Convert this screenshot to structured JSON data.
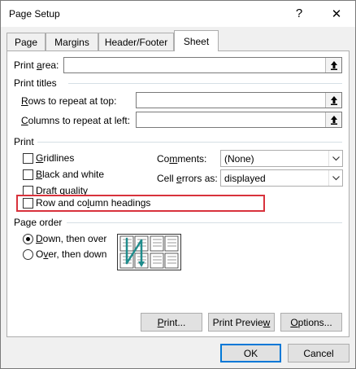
{
  "window": {
    "title": "Page Setup",
    "help_glyph": "?",
    "close_glyph": "✕"
  },
  "tabs": [
    {
      "label": "Page",
      "active": false
    },
    {
      "label": "Margins",
      "active": false
    },
    {
      "label": "Header/Footer",
      "active": false
    },
    {
      "label": "Sheet",
      "active": true
    }
  ],
  "print_area": {
    "label_pre": "Print ",
    "label_key": "a",
    "label_post": "rea:",
    "value": ""
  },
  "print_titles": {
    "heading": "Print titles",
    "rows_label_key": "R",
    "rows_label_post": "ows to repeat at top:",
    "rows_value": "",
    "cols_label_key": "C",
    "cols_label_post": "olumns to repeat at left:",
    "cols_value": ""
  },
  "print": {
    "heading": "Print",
    "gridlines": {
      "key": "G",
      "post": "ridlines",
      "checked": false
    },
    "black_white": {
      "key": "B",
      "post": "lack and white",
      "checked": false
    },
    "draft": {
      "pre": "Draft ",
      "key": "q",
      "post": "uality",
      "checked": false
    },
    "headings": {
      "pre": "Row and co",
      "key": "l",
      "post": "umn headings",
      "checked": false
    },
    "comments": {
      "pre": "Co",
      "key": "m",
      "post": "ments:",
      "value": "(None)"
    },
    "cell_errors": {
      "pre": "Cell ",
      "key": "e",
      "post": "rrors as:",
      "value": "displayed"
    }
  },
  "page_order": {
    "heading": "Page order",
    "down_then_over": {
      "key": "D",
      "post": "own, then over",
      "selected": true
    },
    "over_then_down": {
      "pre": "O",
      "key": "v",
      "post": "er, then down",
      "selected": false
    }
  },
  "buttons": {
    "print": {
      "pre": "",
      "key": "P",
      "post": "rint..."
    },
    "preview": {
      "pre": "Print Previe",
      "key": "w",
      "post": ""
    },
    "options": {
      "pre": "",
      "key": "O",
      "post": "ptions..."
    },
    "ok": "OK",
    "cancel": "Cancel"
  },
  "colors": {
    "highlight": "#d8323c",
    "accent": "#0078d7",
    "arrow_teal": "#1f8c8c"
  }
}
